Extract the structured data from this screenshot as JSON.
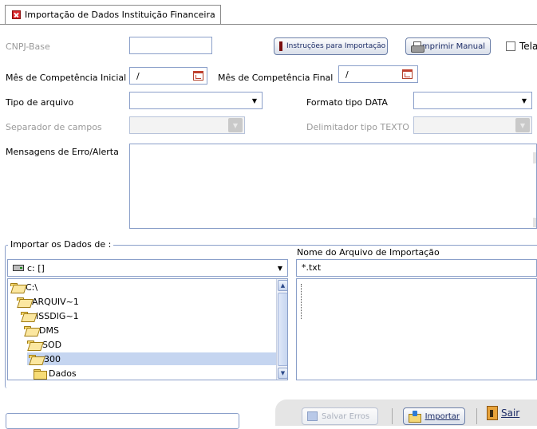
{
  "tab": {
    "title": "Importação de Dados Instituição Financeira"
  },
  "form": {
    "cnpj_label": "CNPJ-Base",
    "cnpj_value": "",
    "instructions_button": "Instruções para Importação",
    "print_manual_button": "Imprimir Manual",
    "tela_label": "Tela",
    "mes_inicial_label": "Mês de Competência Inicial",
    "mes_inicial_value": "/",
    "mes_final_label": "Mês de Competência Final",
    "mes_final_value": "/",
    "tipo_arquivo_label": "Tipo de arquivo",
    "formato_data_label": "Formato tipo DATA",
    "separador_label": "Separador de campos",
    "delimitador_label": "Delimitador tipo TEXTO",
    "mensagens_label": "Mensagens de Erro/Alerta"
  },
  "import_group": {
    "legend": "Importar os Dados de :",
    "drive_value": "c: []",
    "filename_label": "Nome do Arquivo de Importação",
    "filename_value": "*.txt",
    "tree": [
      {
        "label": "C:\\",
        "icon": "folder-open-icon"
      },
      {
        "label": "ARQUIV~1",
        "icon": "folder-open-icon"
      },
      {
        "label": "ISSDIG~1",
        "icon": "folder-open-icon"
      },
      {
        "label": "DMS",
        "icon": "folder-open-icon"
      },
      {
        "label": "SOD",
        "icon": "folder-open-icon"
      },
      {
        "label": "300",
        "icon": "folder-open-icon",
        "selected": true
      },
      {
        "label": "Dados",
        "icon": "folder-icon"
      }
    ]
  },
  "footer": {
    "save_errors_button": "Salvar Erros",
    "import_button": "Importar",
    "exit_button": "Sair"
  }
}
